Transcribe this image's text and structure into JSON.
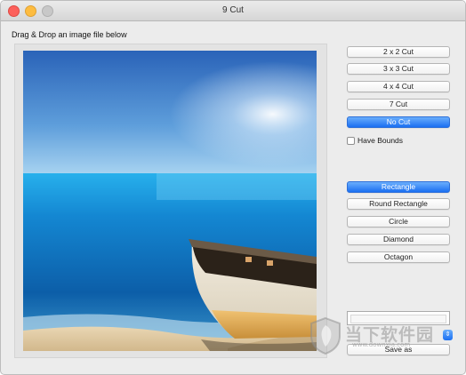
{
  "window": {
    "title": "9 Cut"
  },
  "drop_area": {
    "label": "Drag & Drop an image file below"
  },
  "cut_buttons": [
    "2 x 2 Cut",
    "3 x 3 Cut",
    "4 x 4 Cut",
    "7 Cut",
    "No Cut"
  ],
  "cut_selected": "No Cut",
  "have_bounds": {
    "label": "Have Bounds",
    "checked": false
  },
  "shape_buttons": [
    "Rectangle",
    "Round Rectangle",
    "Circle",
    "Diamond",
    "Octagon"
  ],
  "shape_selected": "Rectangle",
  "save_button": {
    "label": "Save as"
  },
  "watermark": {
    "text": "当下软件园",
    "domain": "www.downxia.com"
  },
  "colors": {
    "accent": "#1a6ff2",
    "window_bg": "#ececec"
  },
  "icons": {
    "watermark_logo": "shield-logo-icon"
  }
}
